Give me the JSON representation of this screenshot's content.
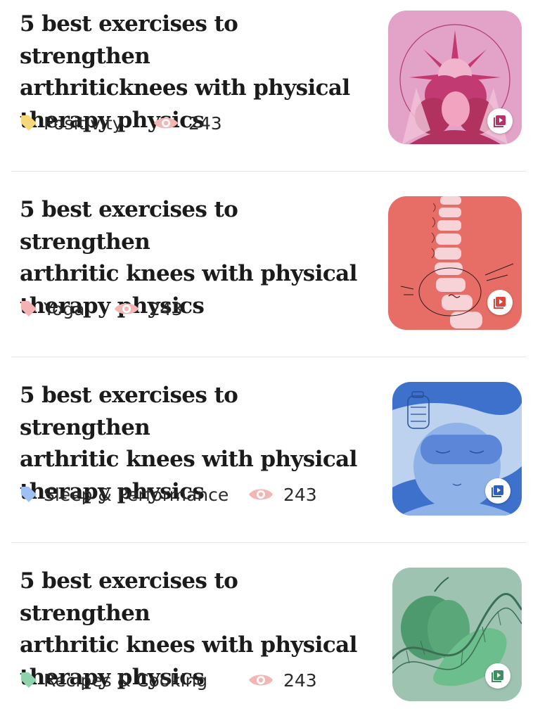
{
  "articles": [
    {
      "title_lines": [
        "5 best exercises to strengthen",
        "arthriticknees with physical",
        "therapy physics"
      ],
      "tag": "Positivity",
      "tag_color": "#f7d878",
      "views": "243",
      "thumb_icon": "sun-woman-illustration",
      "thumb_bg": "#e3a2c8"
    },
    {
      "title_lines": [
        "5 best exercises to strengthen",
        "arthritic knees with physical",
        "therapy physics"
      ],
      "tag": "Yoga",
      "tag_color": "#f4b3b3",
      "views": "243",
      "thumb_icon": "spine-illustration",
      "thumb_bg": "#e76e67"
    },
    {
      "title_lines": [
        "5 best exercises to strengthen",
        "arthritic knees with physical",
        "therapy physics"
      ],
      "tag": "Sleep & Performance",
      "tag_color": "#9fc0f2",
      "views": "243",
      "thumb_icon": "sleep-mask-illustration",
      "thumb_bg": "#3d71cc"
    },
    {
      "title_lines": [
        "5 best exercises to strengthen",
        "arthritic knees with physical",
        "therapy physics"
      ],
      "tag": "Recipes & Cooking",
      "tag_color": "#8fd2ac",
      "views": "243",
      "thumb_icon": "apple-dna-illustration",
      "thumb_bg": "#9ec3b1"
    }
  ],
  "eye_icon_color": "#f2b6b4",
  "video_badge_icon": "video-play-icon"
}
